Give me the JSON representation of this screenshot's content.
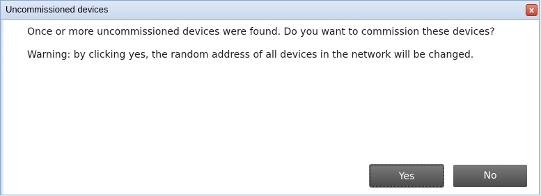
{
  "dialog": {
    "title": "Uncommissioned devices",
    "close_icon": "close-icon",
    "message": "Once or more uncommissioned devices were found. Do you want to commission these devices?",
    "warning": "Warning: by clicking yes, the random address of all devices in the network will be changed.",
    "buttons": {
      "yes_label": "Yes",
      "no_label": "No"
    }
  },
  "colors": {
    "titlebar": "#c9d9ee",
    "button": "#5a5a5a",
    "close": "#c6442a"
  }
}
